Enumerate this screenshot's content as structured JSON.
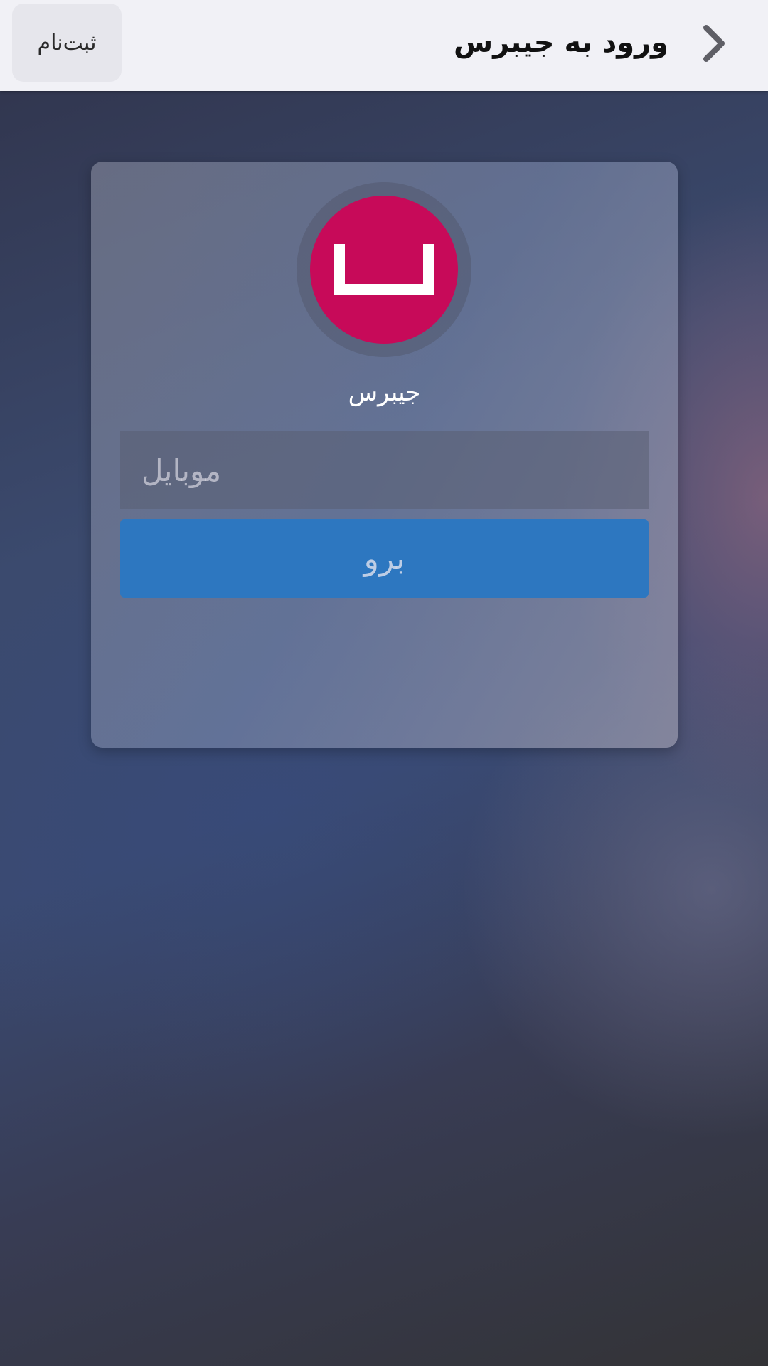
{
  "navbar": {
    "back_icon": "chevron-right-icon",
    "title": "ورود به جیبرس",
    "register_label": "ثبت‌نام"
  },
  "card": {
    "logo_icon": "bracket-logo-icon",
    "brand_name": "جیبرس",
    "mobile_placeholder": "موبایل",
    "mobile_value": "",
    "submit_label": "برو"
  },
  "colors": {
    "navbar_bg": "#f1f1f6",
    "logo_bg": "#c70a59",
    "primary_button": "#2d77c0"
  }
}
